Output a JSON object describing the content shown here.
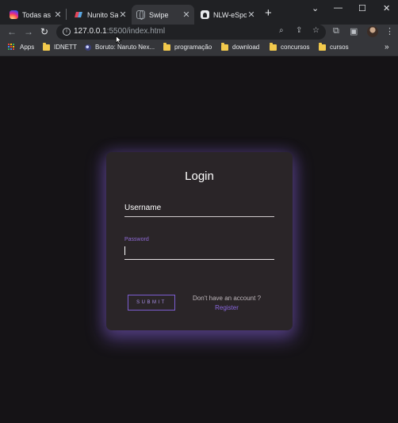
{
  "browser": {
    "tabs": [
      {
        "title": "Todas as p",
        "favicon": "instagram-icon",
        "active": false
      },
      {
        "title": "Nunito Sa",
        "favicon": "google-fonts-icon",
        "active": false
      },
      {
        "title": "Swipe",
        "favicon": "globe-icon",
        "active": true
      },
      {
        "title": "NLW-eSpo",
        "favicon": "github-icon",
        "active": false
      }
    ],
    "new_tab": "+",
    "window_controls": {
      "dropdown": "⌄",
      "minimize": "—",
      "maximize": "☐",
      "close": "✕"
    },
    "url_host": "127.0.0.1",
    "url_path": ":5500/index.html",
    "bookmarks": [
      {
        "label": "Apps",
        "icon": "apps-grid-icon"
      },
      {
        "label": "IDNETT",
        "icon": "folder-icon"
      },
      {
        "label": "Boruto: Naruto Nex...",
        "icon": "boruto-icon"
      },
      {
        "label": "programação",
        "icon": "folder-icon"
      },
      {
        "label": "download",
        "icon": "folder-icon"
      },
      {
        "label": "concursos",
        "icon": "folder-icon"
      },
      {
        "label": "cursos",
        "icon": "folder-icon"
      }
    ],
    "bookmarks_more": "»",
    "accent_color": "#8866dd"
  },
  "login": {
    "title": "Login",
    "username_label": "Username",
    "password_label": "Password",
    "submit_label": "SUBMIT",
    "no_account_text": "Don't have an account ?",
    "register_link": "Register"
  }
}
